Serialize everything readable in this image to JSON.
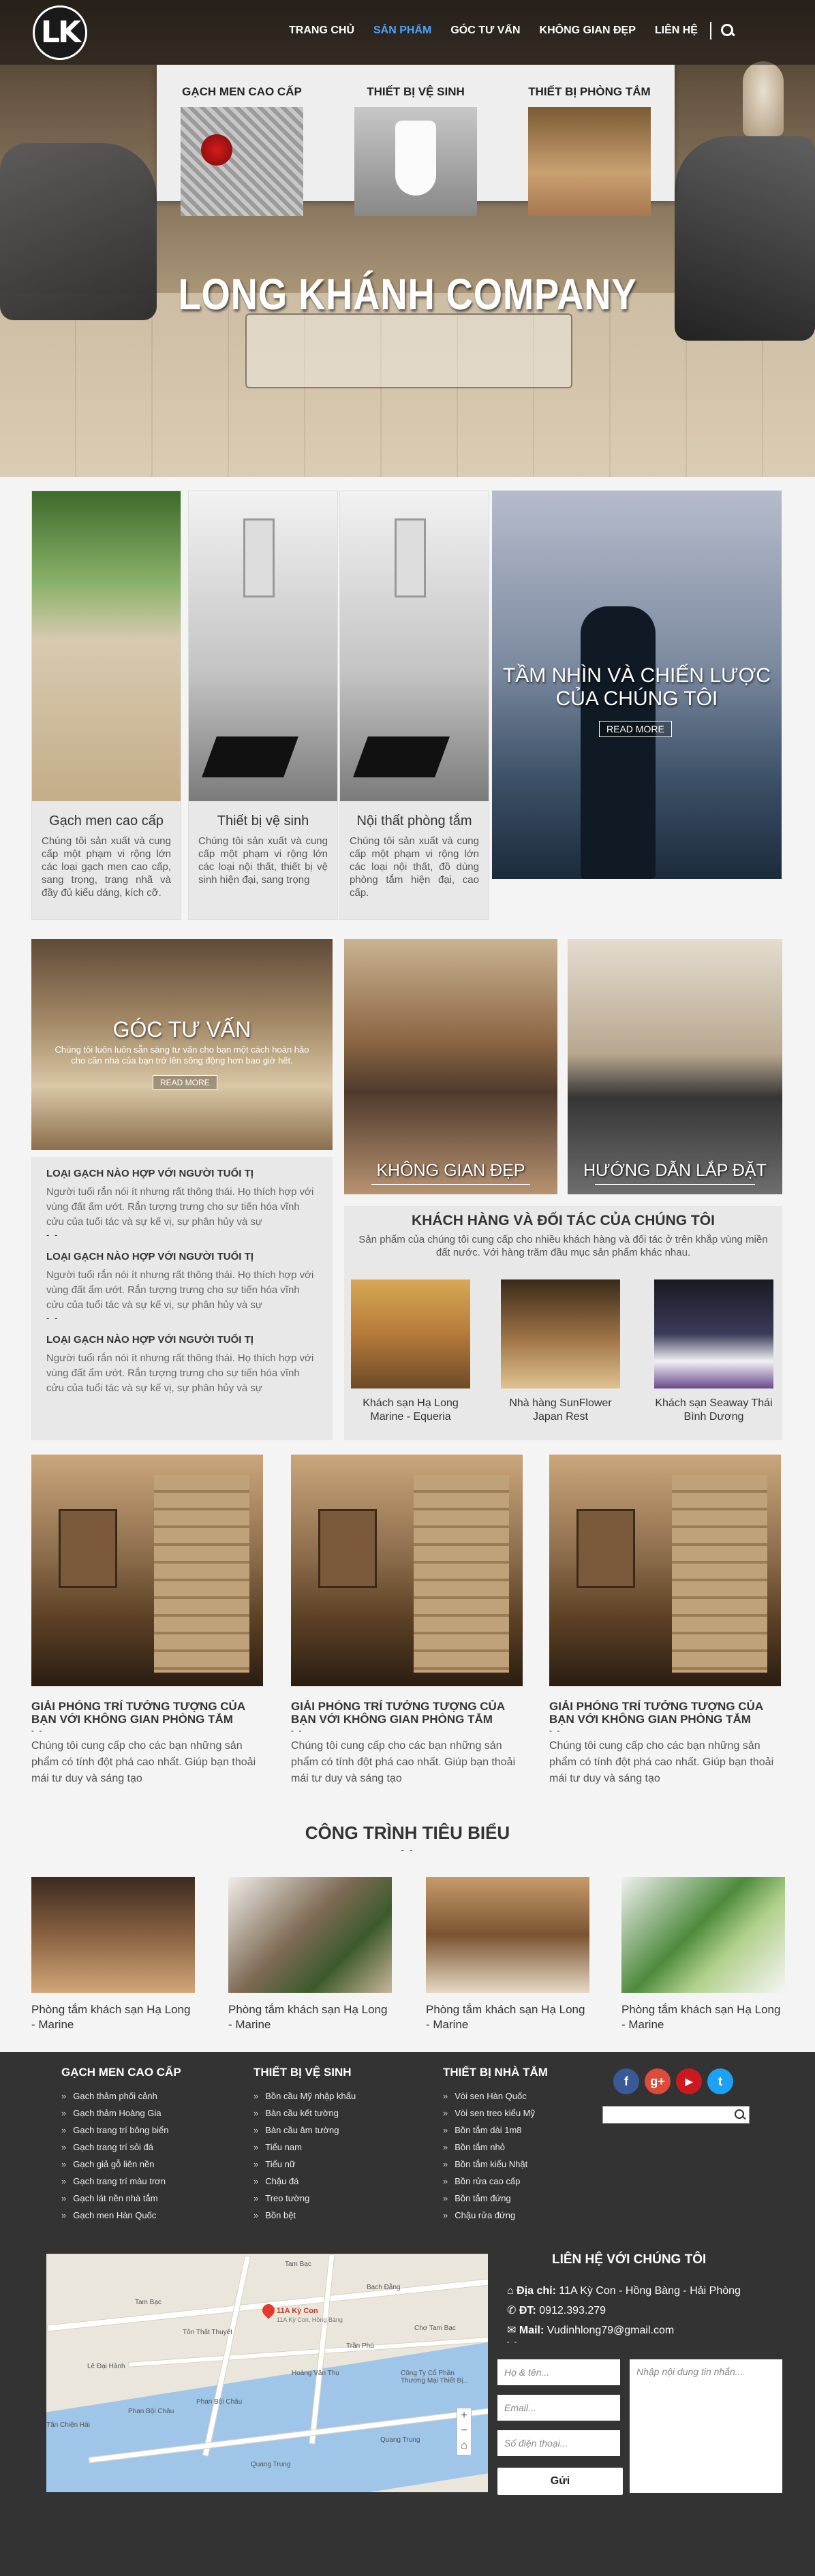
{
  "header": {
    "logo": "LK",
    "nav": [
      "TRANG CHỦ",
      "SẢN PHẨM",
      "GÓC TƯ VẤN",
      "KHÔNG GIAN ĐẸP",
      "LIÊN HỆ"
    ],
    "active_nav": "SẢN PHẨM",
    "mega_menu": [
      "GẠCH MEN CAO CẤP",
      "THIẾT BỊ VỆ SINH",
      "THIẾT BỊ PHÒNG TẮM"
    ],
    "hero_title": "LONG KHÁNH COMPANY"
  },
  "cards": [
    {
      "title": "Gạch men cao cấp",
      "text": "Chúng tôi sản xuất và cung cấp một phạm vi rộng lớn các loại gạch men cao cấp, sang trọng, trang nhã và đầy đủ kiểu dáng, kích cỡ."
    },
    {
      "title": "Thiết bị vệ sinh",
      "text": "Chúng tôi sản xuất và cung cấp một phạm vi rộng lớn các loại nội thất, thiết bị vệ sinh hiện đại, sang trọng"
    },
    {
      "title": "Nội thất phòng tắm",
      "text": "Chúng tôi sản xuất và cung cấp một phạm vi rộng lớn các loại nội thất, đồ dùng phòng tắm hiện đại, cao cấp."
    }
  ],
  "vision": {
    "title": "TẦM NHÌN VÀ CHIẾN LƯỢC CỦA CHÚNG TÔI",
    "button": "READ MORE"
  },
  "advice": {
    "title": "GÓC TƯ VẤN",
    "text": "Chúng tôi luôn luôn sẵn sàng tư vấn cho bạn một cách hoàn hảo cho căn nhà của bạn trở lên sống động hơn bao giờ hết.",
    "button": "READ MORE"
  },
  "news": [
    {
      "title": "LOẠI GẠCH NÀO HỢP VỚI NGƯỜI TUỔI TỊ",
      "text": "Người tuổi rắn nói ít nhưng rất thông thái. Họ thích hợp với vùng đất ẩm ướt. Rắn tượng trưng cho sự tiến hóa vĩnh cửu của tuổi tác và sự kế vị, sự phân hủy và sự"
    },
    {
      "title": "LOẠI GẠCH NÀO HỢP VỚI NGƯỜI TUỔI TỊ",
      "text": "Người tuổi rắn nói ít nhưng rất thông thái. Họ thích hợp với vùng đất ẩm ướt. Rắn tượng trưng cho sự tiến hóa vĩnh cửu của tuổi tác và sự kế vị, sự phân hủy và sự"
    },
    {
      "title": "LOẠI GẠCH NÀO HỢP VỚI NGƯỜI TUỔI TỊ",
      "text": "Người tuổi rắn nói ít nhưng rất thông thái. Họ thích hợp với vùng đất ẩm ướt. Rắn tượng trưng cho sự tiến hóa vĩnh cửu của tuổi tác và sự kế vị, sự phân hủy và sự"
    }
  ],
  "spaces": [
    "KHÔNG GIAN ĐẸP",
    "HƯỚNG DẪN LẮP ĐẶT"
  ],
  "partners": {
    "title": "KHÁCH HÀNG VÀ ĐỐI TÁC CỦA CHÚNG TÔI",
    "text": "Sản phẩm của chúng tôi cung cấp cho nhiều khách hàng và đối tác ở trên khắp vùng miền đất nước. Với hàng trăm đầu mục sản phẩm khác nhau.",
    "items": [
      "Khách sạn Hạ Long Marine - Equeria",
      "Nhà hàng SunFlower Japan Rest",
      "Khách sạn Seaway Thái Bình Dương"
    ]
  },
  "products": [
    {
      "title": "GIẢI PHÓNG TRÍ TƯỞNG TƯỢNG CỦA BẠN VỚI KHÔNG GIAN PHÒNG TẮM",
      "text": "Chúng tôi cung cấp cho các bạn những sản phẩm có tính đột phá cao nhất. Giúp bạn thoải mái tư duy và sáng tạo"
    },
    {
      "title": "GIẢI PHÓNG TRÍ TƯỞNG TƯỢNG CỦA BẠN VỚI KHÔNG GIAN PHÒNG TẮM",
      "text": "Chúng tôi cung cấp cho các bạn những sản phẩm có tính đột phá cao nhất. Giúp bạn thoải mái tư duy và sáng tạo"
    },
    {
      "title": "GIẢI PHÓNG TRÍ TƯỞNG TƯỢNG CỦA BẠN VỚI KHÔNG GIAN PHÒNG TẮM",
      "text": "Chúng tôi cung cấp cho các bạn những sản phẩm có tính đột phá cao nhất. Giúp bạn thoải mái tư duy và sáng tạo"
    }
  ],
  "works": {
    "title": "CÔNG TRÌNH TIÊU BIỂU",
    "items": [
      "Phòng tắm khách sạn Hạ Long - Marine",
      "Phòng tắm khách sạn Hạ Long - Marine",
      "Phòng tắm khách sạn Hạ Long - Marine",
      "Phòng tắm khách sạn Hạ Long - Marine"
    ]
  },
  "footer": {
    "cols": [
      {
        "title": "GẠCH MEN CAO CẤP",
        "items": [
          "Gạch thảm phối cảnh",
          "Gạch thảm Hoàng Gia",
          "Gạch trang trí bông biển",
          "Gạch trang trí sỏi đá",
          "Gạch giả gỗ liên nền",
          "Gạch trang trí màu trơn",
          "Gạch lát nền nhà tắm",
          "Gạch men Hàn Quốc"
        ]
      },
      {
        "title": "THIẾT BỊ VỆ SINH",
        "items": [
          "Bồn cầu Mỹ nhập khẩu",
          "Bàn cầu kết tường",
          "Bàn cầu âm tường",
          "Tiểu nam",
          "Tiểu nữ",
          "Chậu đá",
          "Treo tường",
          "Bồn bệt"
        ]
      },
      {
        "title": "THIẾT BỊ NHÀ TẮM",
        "items": [
          "Vòi sen Hàn Quốc",
          "Vòi sen treo kiểu Mỹ",
          "Bồn tắm dài 1m8",
          "Bồn tắm nhỏ",
          "Bồn tắm kiểu Nhật",
          "Bồn rửa cao cấp",
          "Bồn tắm đứng",
          "Chậu rửa đứng"
        ]
      }
    ],
    "social": [
      {
        "icon": "facebook-icon",
        "glyph": "f",
        "color": "#3b5998"
      },
      {
        "icon": "google-plus-icon",
        "glyph": "g+",
        "color": "#dd4b39"
      },
      {
        "icon": "youtube-icon",
        "glyph": "▶",
        "color": "#cc181e"
      },
      {
        "icon": "twitter-icon",
        "glyph": "t",
        "color": "#1da1f2"
      }
    ],
    "contact_title": "LIÊN HỆ VỚI CHÚNG TÔI",
    "address_label": "Địa chỉ:",
    "address": "11A Kỳ Con - Hồng Bàng - Hải Phòng",
    "phone_label": "ĐT:",
    "phone": "0912.393.279",
    "mail_label": "Mail:",
    "mail": "Vudinhlong79@gmail.com",
    "form": {
      "name_placeholder": "Họ & tên...",
      "email_placeholder": "Email...",
      "phone_placeholder": "Số điện thoại...",
      "message_placeholder": "Nhập nội dung tin nhắn...",
      "send": "Gửi"
    },
    "map": {
      "pin_label": "11A Kỳ Con",
      "pin_sub": "11A Kỳ Con, Hồng Bàng",
      "labels": [
        "Tam Bạc",
        "Tam Bạc",
        "Chợ Tam Bạc",
        "Phan Bội Châu",
        "Phan Bội Châu",
        "Quang Trung",
        "Quang Trung",
        "Công Ty Cổ Phần Thương Mại Thiết Bị...",
        "Bạch Đằng",
        "Tân Chiện Hải",
        "Hoàng Văn Thụ",
        "Tôn Thất Thuyết",
        "Trần Phú",
        "Lê Đại Hành"
      ]
    }
  }
}
